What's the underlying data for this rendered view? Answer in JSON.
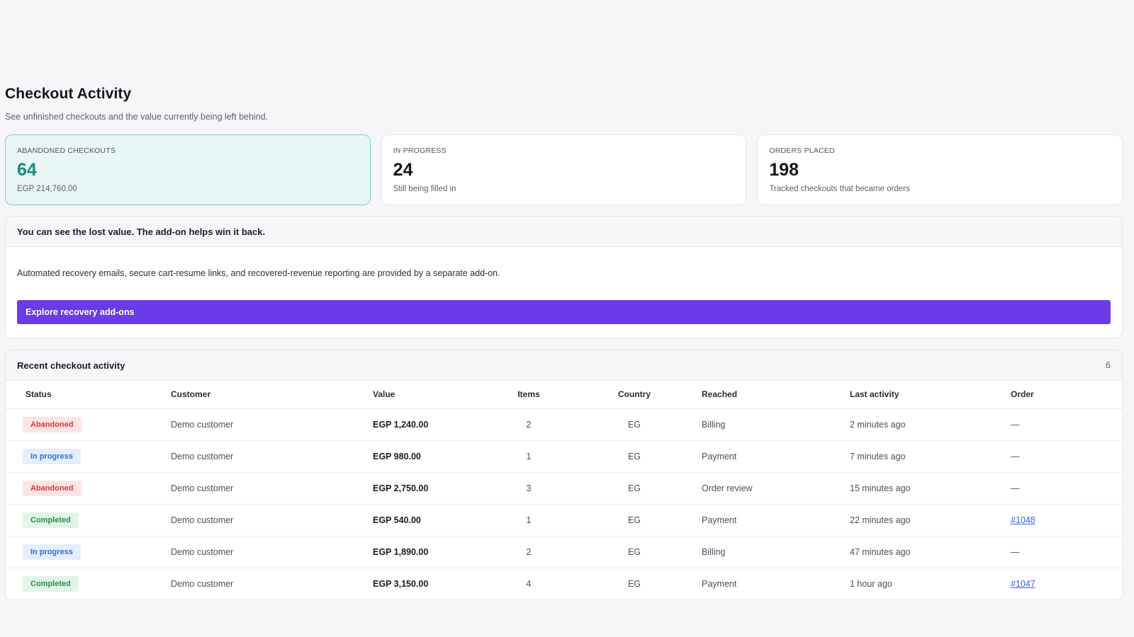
{
  "page": {
    "title": "Checkout Activity",
    "subtitle": "See unfinished checkouts and the value currently being left behind."
  },
  "stats": [
    {
      "label": "ABANDONED CHECKOUTS",
      "value": "64",
      "note": "EGP 214,760.00"
    },
    {
      "label": "IN PROGRESS",
      "value": "24",
      "note": "Still being filled in"
    },
    {
      "label": "ORDERS PLACED",
      "value": "198",
      "note": "Tracked checkouts that became orders"
    }
  ],
  "upsell": {
    "heading": "You can see the lost value. The add-on helps win it back.",
    "text": "Automated recovery emails, secure cart-resume links, and recovered-revenue reporting are provided by a separate add-on.",
    "button_label": "Explore recovery add-ons"
  },
  "activity": {
    "title": "Recent checkout activity",
    "count": "6",
    "columns": {
      "status": "Status",
      "customer": "Customer",
      "value": "Value",
      "items": "Items",
      "country": "Country",
      "reached": "Reached",
      "last_activity": "Last activity",
      "order": "Order"
    },
    "rows": [
      {
        "status": "Abandoned",
        "customer": "Demo customer",
        "value": "EGP 1,240.00",
        "items": "2",
        "country": "EG",
        "reached": "Billing",
        "last_activity": "2 minutes ago",
        "order": "—"
      },
      {
        "status": "In progress",
        "customer": "Demo customer",
        "value": "EGP 980.00",
        "items": "1",
        "country": "EG",
        "reached": "Payment",
        "last_activity": "7 minutes ago",
        "order": "—"
      },
      {
        "status": "Abandoned",
        "customer": "Demo customer",
        "value": "EGP 2,750.00",
        "items": "3",
        "country": "EG",
        "reached": "Order review",
        "last_activity": "15 minutes ago",
        "order": "—"
      },
      {
        "status": "Completed",
        "customer": "Demo customer",
        "value": "EGP 540.00",
        "items": "1",
        "country": "EG",
        "reached": "Payment",
        "last_activity": "22 minutes ago",
        "order": "#1048"
      },
      {
        "status": "In progress",
        "customer": "Demo customer",
        "value": "EGP 1,890.00",
        "items": "2",
        "country": "EG",
        "reached": "Billing",
        "last_activity": "47 minutes ago",
        "order": "—"
      },
      {
        "status": "Completed",
        "customer": "Demo customer",
        "value": "EGP 3,150.00",
        "items": "4",
        "country": "EG",
        "reached": "Payment",
        "last_activity": "1 hour ago",
        "order": "#1047"
      }
    ]
  },
  "colors": {
    "accent": "#6a3be6",
    "highlight_card_bg": "#e8f6f5",
    "highlight_value": "#1a8a7e",
    "abandoned": "#d23a3a",
    "in_progress": "#2e6ed8",
    "completed": "#2a8a4e",
    "link": "#3b5ee8"
  }
}
